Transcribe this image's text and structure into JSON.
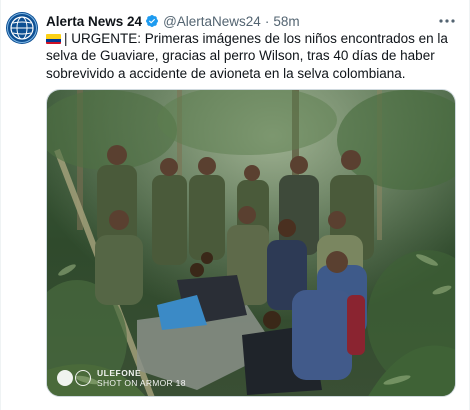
{
  "tweet": {
    "display_name": "Alerta News 24",
    "handle": "@AlertaNews24",
    "separator": "·",
    "time": "58m",
    "text": "| URGENTE: Primeras imágenes de los niños encontrados en la selva de Guaviare, gracias al perro Wilson, tras 40 días de haber sobrevivido a accidente de avioneta en la selva colombiana.",
    "flag_colors": [
      "#fcd116",
      "#003893",
      "#ce1126"
    ]
  },
  "media": {
    "watermark_brand": "ULEFONE",
    "watermark_sub": "SHOT ON ARMOR 18"
  },
  "icons": {
    "verified": "verified-badge-icon",
    "more": "more-options-icon",
    "avatar": "globe-logo-icon"
  },
  "colors": {
    "verified_blue": "#1d9bf0",
    "secondary_text": "#536471",
    "primary_text": "#0f1419"
  }
}
